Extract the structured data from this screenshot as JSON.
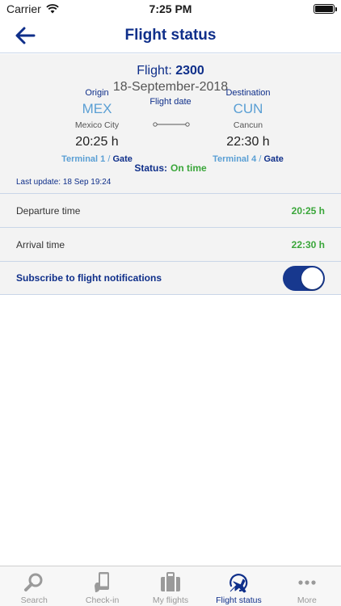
{
  "status_bar": {
    "carrier": "Carrier",
    "time": "7:25 PM"
  },
  "nav": {
    "title": "Flight status"
  },
  "flight": {
    "label": "Flight:",
    "number": "2300",
    "date": "18-September-2018",
    "date_label": "Flight date",
    "origin": {
      "label": "Origin",
      "code": "MEX",
      "city": "Mexico City",
      "time": "20:25 h",
      "terminal": "Terminal 1",
      "separator": "/",
      "gate": "Gate"
    },
    "destination": {
      "label": "Destination",
      "code": "CUN",
      "city": "Cancun",
      "time": "22:30 h",
      "terminal": "Terminal 4",
      "separator": "/",
      "gate": "Gate"
    },
    "status_label": "Status:",
    "status_value": "On time",
    "last_update": "Last update: 18 Sep 19:24"
  },
  "rows": {
    "departure_label": "Departure time",
    "departure_value": "20:25 h",
    "arrival_label": "Arrival time",
    "arrival_value": "22:30 h",
    "subscribe_label": "Subscribe to flight notifications",
    "subscribe_on": true
  },
  "tabs": [
    {
      "label": "Search",
      "icon": "search-icon"
    },
    {
      "label": "Check-in",
      "icon": "phone-check-in-icon"
    },
    {
      "label": "My flights",
      "icon": "suitcase-icon"
    },
    {
      "label": "Flight status",
      "icon": "airplane-globe-icon",
      "active": true
    },
    {
      "label": "More",
      "icon": "more-dots-icon"
    }
  ],
  "colors": {
    "brand": "#0f2f8a",
    "accent": "#5a9fd4",
    "success": "#3aa63a",
    "toggle": "#17388e"
  }
}
